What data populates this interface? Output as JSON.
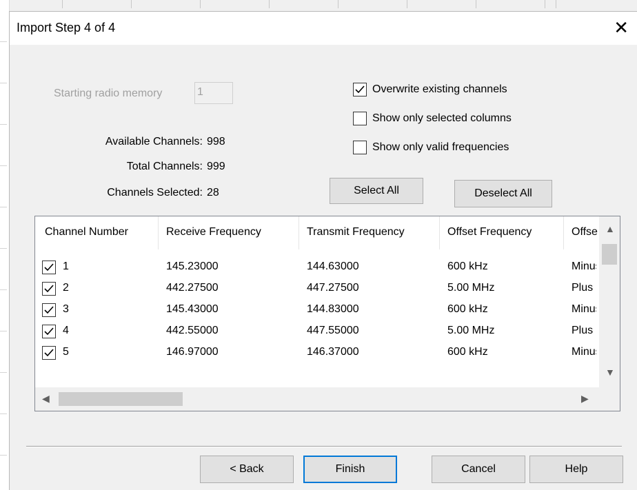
{
  "dialog": {
    "title": "Import Step 4 of 4",
    "close_glyph": "✕"
  },
  "memory": {
    "label": "Starting radio memory",
    "value": "1"
  },
  "stats": {
    "available_label": "Available Channels:",
    "available_value": "998",
    "total_label": "Total Channels:",
    "total_value": "999",
    "selected_label": "Channels Selected:",
    "selected_value": "28"
  },
  "options": {
    "overwrite_label": "Overwrite existing channels",
    "overwrite_checked": true,
    "selected_cols_label": "Show only selected columns",
    "selected_cols_checked": false,
    "valid_freq_label": "Show only valid frequencies",
    "valid_freq_checked": false
  },
  "buttons": {
    "select_all": "Select All",
    "deselect_all": "Deselect All",
    "back": "< Back",
    "finish": "Finish",
    "cancel": "Cancel",
    "help": "Help"
  },
  "table": {
    "columns": [
      "Channel Number",
      "Receive Frequency",
      "Transmit Frequency",
      "Offset Frequency",
      "Offset Direction"
    ],
    "rows": [
      [
        "1",
        "145.23000",
        "144.63000",
        "600 kHz",
        "Minus"
      ],
      [
        "2",
        "442.27500",
        "447.27500",
        "5.00 MHz",
        "Plus"
      ],
      [
        "3",
        "145.43000",
        "144.83000",
        "600 kHz",
        "Minus"
      ],
      [
        "4",
        "442.55000",
        "447.55000",
        "5.00 MHz",
        "Plus"
      ],
      [
        "5",
        "146.97000",
        "146.37000",
        "600 kHz",
        "Minus"
      ]
    ]
  }
}
